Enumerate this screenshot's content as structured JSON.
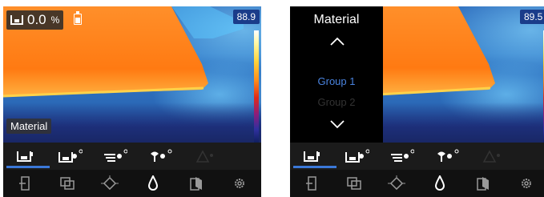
{
  "left": {
    "reading": {
      "value": "0.0",
      "unit": "%"
    },
    "max_temp": "88.9",
    "material_label": "Material"
  },
  "right": {
    "max_temp": "89.5",
    "panel": {
      "title": "Material",
      "group_selected": "Group 1",
      "group_next": "Group 2"
    }
  },
  "toolbar_top": [
    "material-mode-1-icon",
    "material-mode-2-icon",
    "material-mode-3-icon",
    "material-mode-4-icon",
    "material-mode-5-icon"
  ],
  "toolbar_bottom": [
    "exit-icon",
    "image-mode-icon",
    "focus-icon",
    "moisture-drop-icon",
    "reference-icon",
    "gear-icon"
  ],
  "colors": {
    "accent": "#3b78d8",
    "toolbar": "#1b1b1b",
    "hot": "#ff7a1a"
  }
}
